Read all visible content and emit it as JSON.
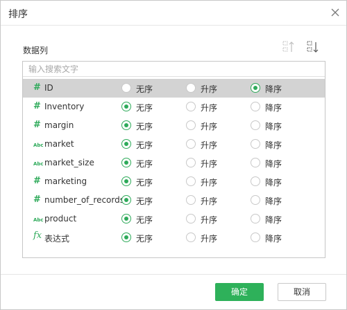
{
  "dialog": {
    "title": "排序",
    "close_icon": "close-icon"
  },
  "section": {
    "label": "数据列",
    "sort_asc_icon": "sort-ascending-icon",
    "sort_desc_icon": "sort-descending-icon"
  },
  "search": {
    "placeholder": "输入搜索文字",
    "value": ""
  },
  "options": [
    "无序",
    "升序",
    "降序"
  ],
  "rows": [
    {
      "type": "number",
      "type_symbol": "#",
      "name": "ID",
      "selected_option": "降序",
      "highlighted": true
    },
    {
      "type": "number",
      "type_symbol": "#",
      "name": "Inventory",
      "selected_option": "无序",
      "highlighted": false
    },
    {
      "type": "number",
      "type_symbol": "#",
      "name": "margin",
      "selected_option": "无序",
      "highlighted": false
    },
    {
      "type": "text",
      "type_symbol": "Abc",
      "name": "market",
      "selected_option": "无序",
      "highlighted": false
    },
    {
      "type": "text",
      "type_symbol": "Abc",
      "name": "market_size",
      "selected_option": "无序",
      "highlighted": false
    },
    {
      "type": "number",
      "type_symbol": "#",
      "name": "marketing",
      "selected_option": "无序",
      "highlighted": false
    },
    {
      "type": "number",
      "type_symbol": "#",
      "name": "number_of_records",
      "selected_option": "无序",
      "highlighted": false
    },
    {
      "type": "text",
      "type_symbol": "Abc",
      "name": "product",
      "selected_option": "无序",
      "highlighted": false
    },
    {
      "type": "formula",
      "type_symbol": "fx",
      "name": "表达式",
      "selected_option": "无序",
      "highlighted": false
    }
  ],
  "footer": {
    "ok_label": "确定",
    "cancel_label": "取消"
  },
  "colors": {
    "accent": "#2eaa5a",
    "selected_row": "#d3d3d3",
    "border": "#c6c6c6"
  }
}
